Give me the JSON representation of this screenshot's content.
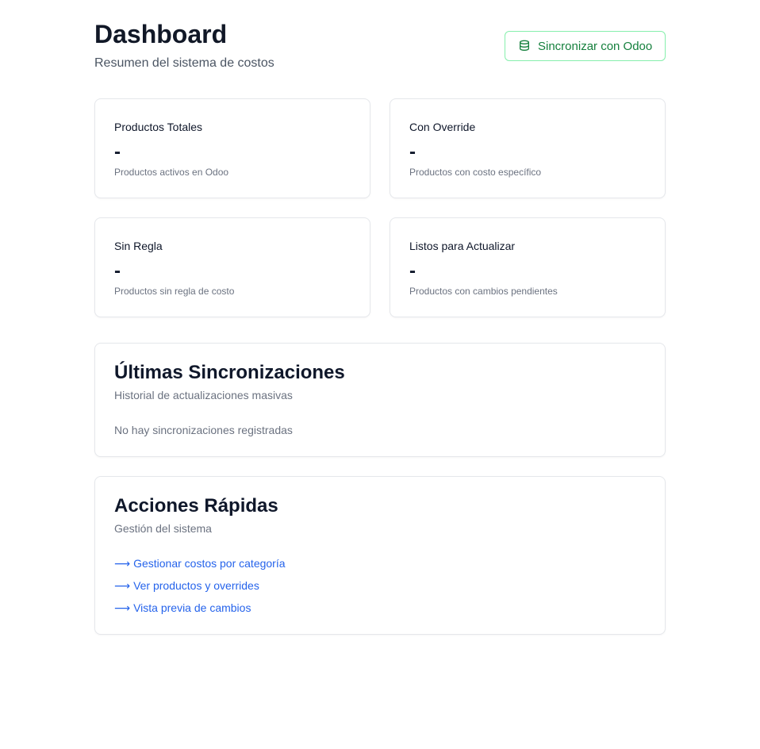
{
  "header": {
    "title": "Dashboard",
    "subtitle": "Resumen del sistema de costos",
    "sync_button_label": "Sincronizar con Odoo",
    "sync_button_icon": "database-icon"
  },
  "stats": [
    {
      "label": "Productos Totales",
      "value": "-",
      "description": "Productos activos en Odoo"
    },
    {
      "label": "Con Override",
      "value": "-",
      "description": "Productos con costo específico"
    },
    {
      "label": "Sin Regla",
      "value": "-",
      "description": "Productos sin regla de costo"
    },
    {
      "label": "Listos para Actualizar",
      "value": "-",
      "description": "Productos con cambios pendientes"
    }
  ],
  "sync_history": {
    "title": "Últimas Sincronizaciones",
    "subtitle": "Historial de actualizaciones masivas",
    "empty_text": "No hay sincronizaciones registradas"
  },
  "quick_actions": {
    "title": "Acciones Rápidas",
    "subtitle": "Gestión del sistema",
    "arrow": "⟶",
    "links": [
      {
        "label": "Gestionar costos por categoría"
      },
      {
        "label": "Ver productos y overrides"
      },
      {
        "label": "Vista previa de cambios"
      }
    ]
  },
  "colors": {
    "accent_green": "#15803d",
    "link_blue": "#2563eb",
    "border": "#e5e7eb"
  }
}
